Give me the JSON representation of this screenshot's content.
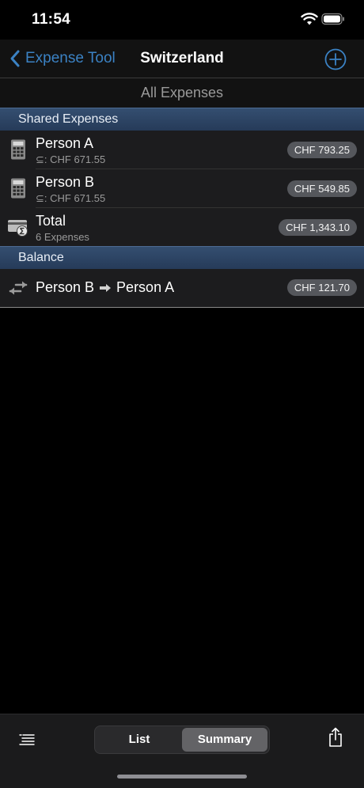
{
  "status_bar": {
    "time": "11:54"
  },
  "nav": {
    "back_label": "Expense Tool",
    "title": "Switzerland"
  },
  "subheader": "All Expenses",
  "sections": {
    "shared_title": "Shared Expenses",
    "balance_title": "Balance"
  },
  "shared_rows": [
    {
      "title": "Person A",
      "subtitle": "⊆: CHF 671.55",
      "amount": "CHF 793.25",
      "icon": "calculator-icon"
    },
    {
      "title": "Person B",
      "subtitle": "⊆: CHF 671.55",
      "amount": "CHF 549.85",
      "icon": "calculator-icon"
    },
    {
      "title": "Total",
      "subtitle": "6 Expenses",
      "amount": "CHF 1,343.10",
      "icon": "money-sum-icon"
    }
  ],
  "balance": {
    "from": "Person B",
    "to": "Person A",
    "amount": "CHF 121.70"
  },
  "toolbar": {
    "segments": [
      "List",
      "Summary"
    ],
    "selected": "Summary"
  },
  "colors": {
    "accent": "#3b82c4",
    "section_header": "#2d4464",
    "background": "#000000"
  }
}
